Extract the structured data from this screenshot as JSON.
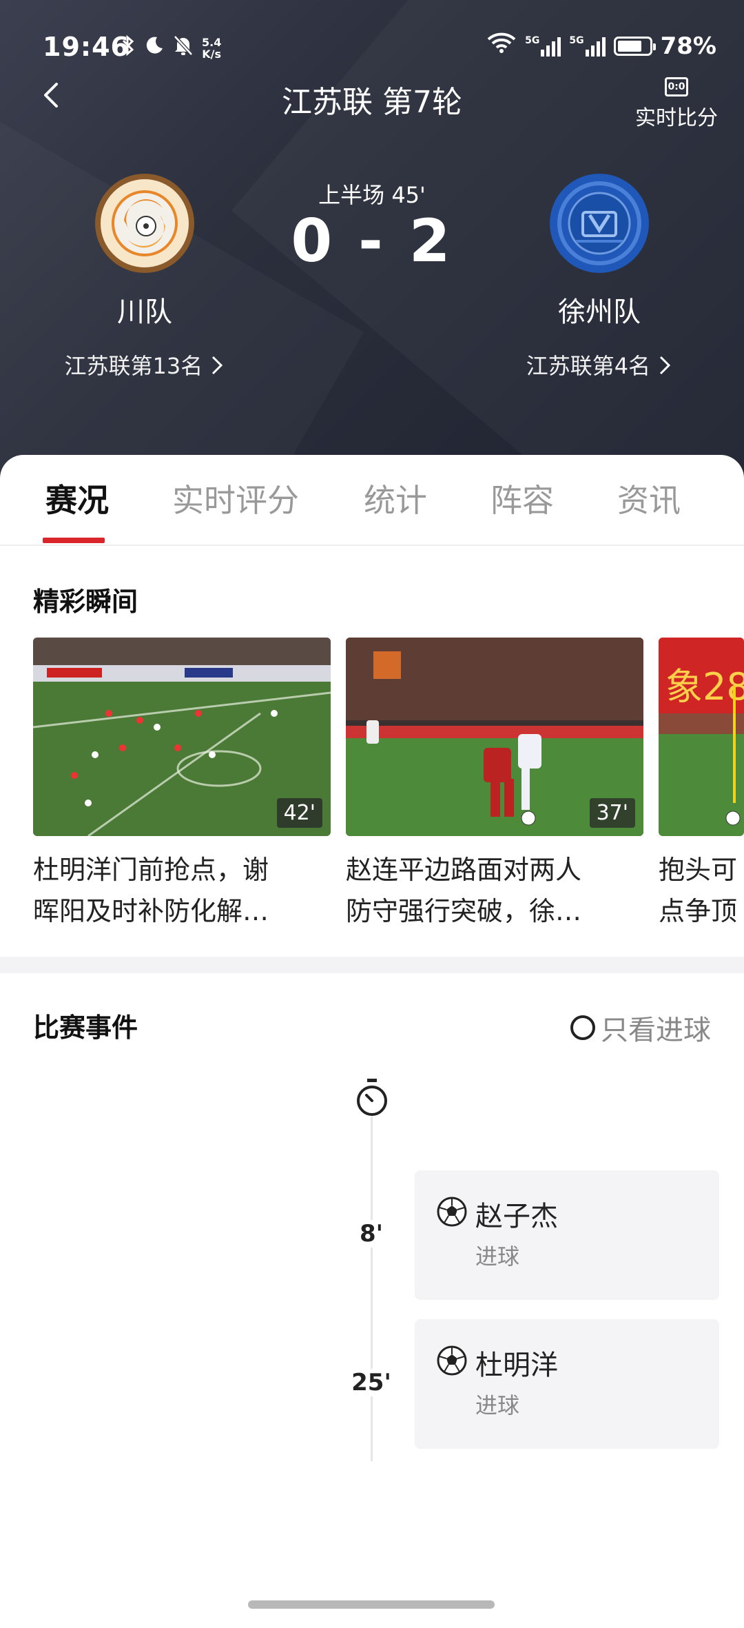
{
  "status_bar": {
    "time": "19:46",
    "net_speed_value": "5.4",
    "net_speed_unit": "K/s",
    "signal1_label": "5G",
    "signal2_label": "5G",
    "battery": "78%",
    "battery_level": 0.78
  },
  "header": {
    "title": "江苏联 第7轮",
    "live_score_icon_text": "0:0",
    "live_score_label": "实时比分"
  },
  "match": {
    "period": "上半场 45'",
    "score": "0 - 2",
    "home": {
      "name": "川队",
      "rank": "江苏联第13名"
    },
    "away": {
      "name": "徐州队",
      "rank": "江苏联第4名"
    }
  },
  "tabs": [
    {
      "label": "赛况",
      "active": true
    },
    {
      "label": "实时评分",
      "active": false
    },
    {
      "label": "统计",
      "active": false
    },
    {
      "label": "阵容",
      "active": false
    },
    {
      "label": "资讯",
      "active": false
    }
  ],
  "highlights": {
    "title": "精彩瞬间",
    "items": [
      {
        "minute": "42'",
        "caption_line1": "杜明洋门前抢点，谢",
        "caption_line2": "晖阳及时补防化解…"
      },
      {
        "minute": "37'",
        "caption_line1": "赵连平边路面对两人",
        "caption_line2": "防守强行突破，徐…"
      },
      {
        "minute": "",
        "caption_line1": "抱头可",
        "caption_line2": "点争顶"
      }
    ]
  },
  "events": {
    "title": "比赛事件",
    "only_goals_label": "只看进球",
    "items": [
      {
        "minute": "8'",
        "player": "赵子杰",
        "type": "进球"
      },
      {
        "minute": "25'",
        "player": "杜明洋",
        "type": "进球"
      }
    ]
  },
  "colors": {
    "accent_red": "#d9262c",
    "header_bg": "#2b2f3c",
    "away_blue": "#1f58b8",
    "home_orange": "#e8862a"
  }
}
